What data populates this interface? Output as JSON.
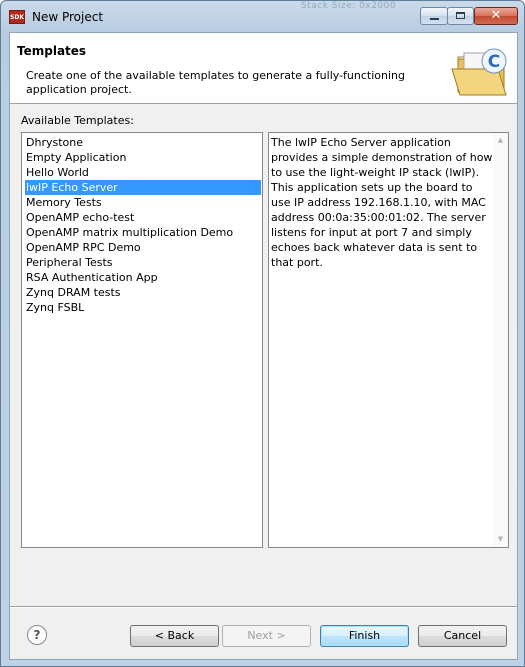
{
  "window": {
    "title": "New Project",
    "app_icon_text": "SDK",
    "background_ghost_text": "Stack Size: 0x2000"
  },
  "header": {
    "title": "Templates",
    "description": "Create one of the available templates to generate a fully-functioning application project."
  },
  "templates_label": "Available Templates:",
  "templates": [
    {
      "label": "Dhrystone",
      "selected": false
    },
    {
      "label": "Empty Application",
      "selected": false
    },
    {
      "label": "Hello World",
      "selected": false
    },
    {
      "label": "lwIP Echo Server",
      "selected": true
    },
    {
      "label": "Memory Tests",
      "selected": false
    },
    {
      "label": "OpenAMP echo-test",
      "selected": false
    },
    {
      "label": "OpenAMP matrix multiplication Demo",
      "selected": false
    },
    {
      "label": "OpenAMP RPC Demo",
      "selected": false
    },
    {
      "label": "Peripheral Tests",
      "selected": false
    },
    {
      "label": "RSA Authentication App",
      "selected": false
    },
    {
      "label": "Zynq DRAM tests",
      "selected": false
    },
    {
      "label": "Zynq FSBL",
      "selected": false
    }
  ],
  "description_text": "The lwIP Echo Server application provides a simple demonstration of how to use the light-weight IP stack (lwIP). This application sets up the board to use IP address 192.168.1.10, with MAC address 00:0a:35:00:01:02. The server listens for input at port 7 and simply echoes back whatever data is sent to that port.",
  "buttons": {
    "help": "?",
    "back": "< Back",
    "next": "Next >",
    "finish": "Finish",
    "cancel": "Cancel"
  },
  "icons": {
    "app": "sdk-app-icon",
    "minimize": "minimize-icon",
    "maximize": "maximize-icon",
    "close": "close-icon",
    "header": "c-folder-icon",
    "help": "help-icon",
    "scroll_up": "scroll-up-arrow-icon",
    "scroll_down": "scroll-down-arrow-icon"
  },
  "colors": {
    "selection": "#3399ff",
    "close_button": "#c7472f",
    "title_bar": "#c4d6e9"
  }
}
